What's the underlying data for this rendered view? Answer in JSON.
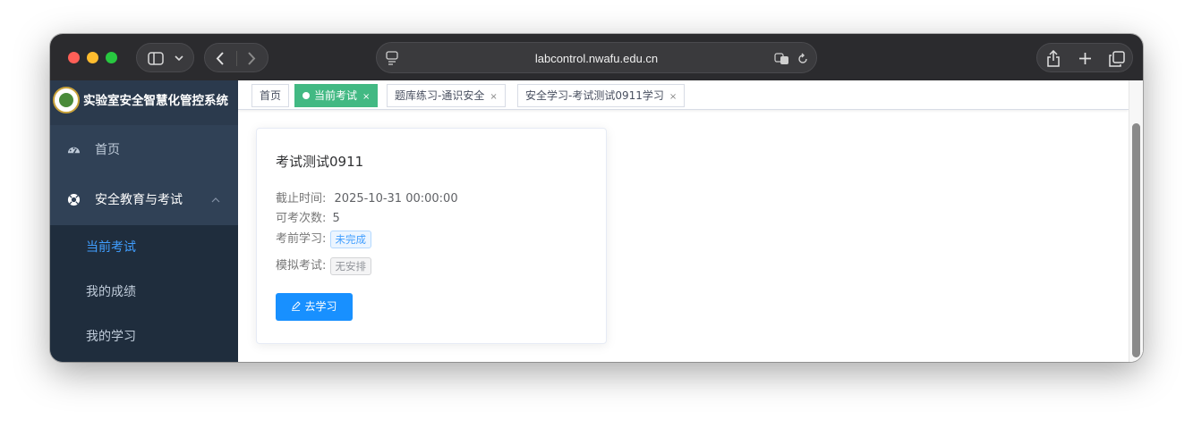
{
  "browser": {
    "url": "labcontrol.nwafu.edu.cn"
  },
  "app": {
    "title": "实验室安全智慧化管控系统"
  },
  "sidebar": {
    "items": [
      {
        "label": "首页",
        "icon": "dashboard-icon"
      },
      {
        "label": "安全教育与考试",
        "icon": "lifebuoy-icon",
        "expanded": true
      }
    ],
    "submenu": [
      {
        "label": "当前考试",
        "active": true
      },
      {
        "label": "我的成绩",
        "active": false
      },
      {
        "label": "我的学习",
        "active": false
      }
    ]
  },
  "tabs": [
    {
      "label": "首页",
      "closable": false,
      "active": false
    },
    {
      "label": "当前考试",
      "closable": true,
      "active": true
    },
    {
      "label": "题库练习-通识安全",
      "closable": true,
      "active": false
    },
    {
      "label": "安全学习-考试测试0911学习",
      "closable": true,
      "active": false
    }
  ],
  "exam_card": {
    "title": "考试测试0911",
    "deadline_label": "截止时间:",
    "deadline_value": "2025-10-31 00:00:00",
    "attempts_label": "可考次数:",
    "attempts_value": "5",
    "pre_study_label": "考前学习:",
    "pre_study_status": "未完成",
    "mock_exam_label": "模拟考试:",
    "mock_exam_status": "无安排",
    "study_button": "去学习"
  },
  "colors": {
    "sidebar_bg": "#304156",
    "submenu_bg": "#1f2d3d",
    "active_menu": "#409eff",
    "active_tab": "#42b983",
    "primary_button": "#1890ff"
  }
}
